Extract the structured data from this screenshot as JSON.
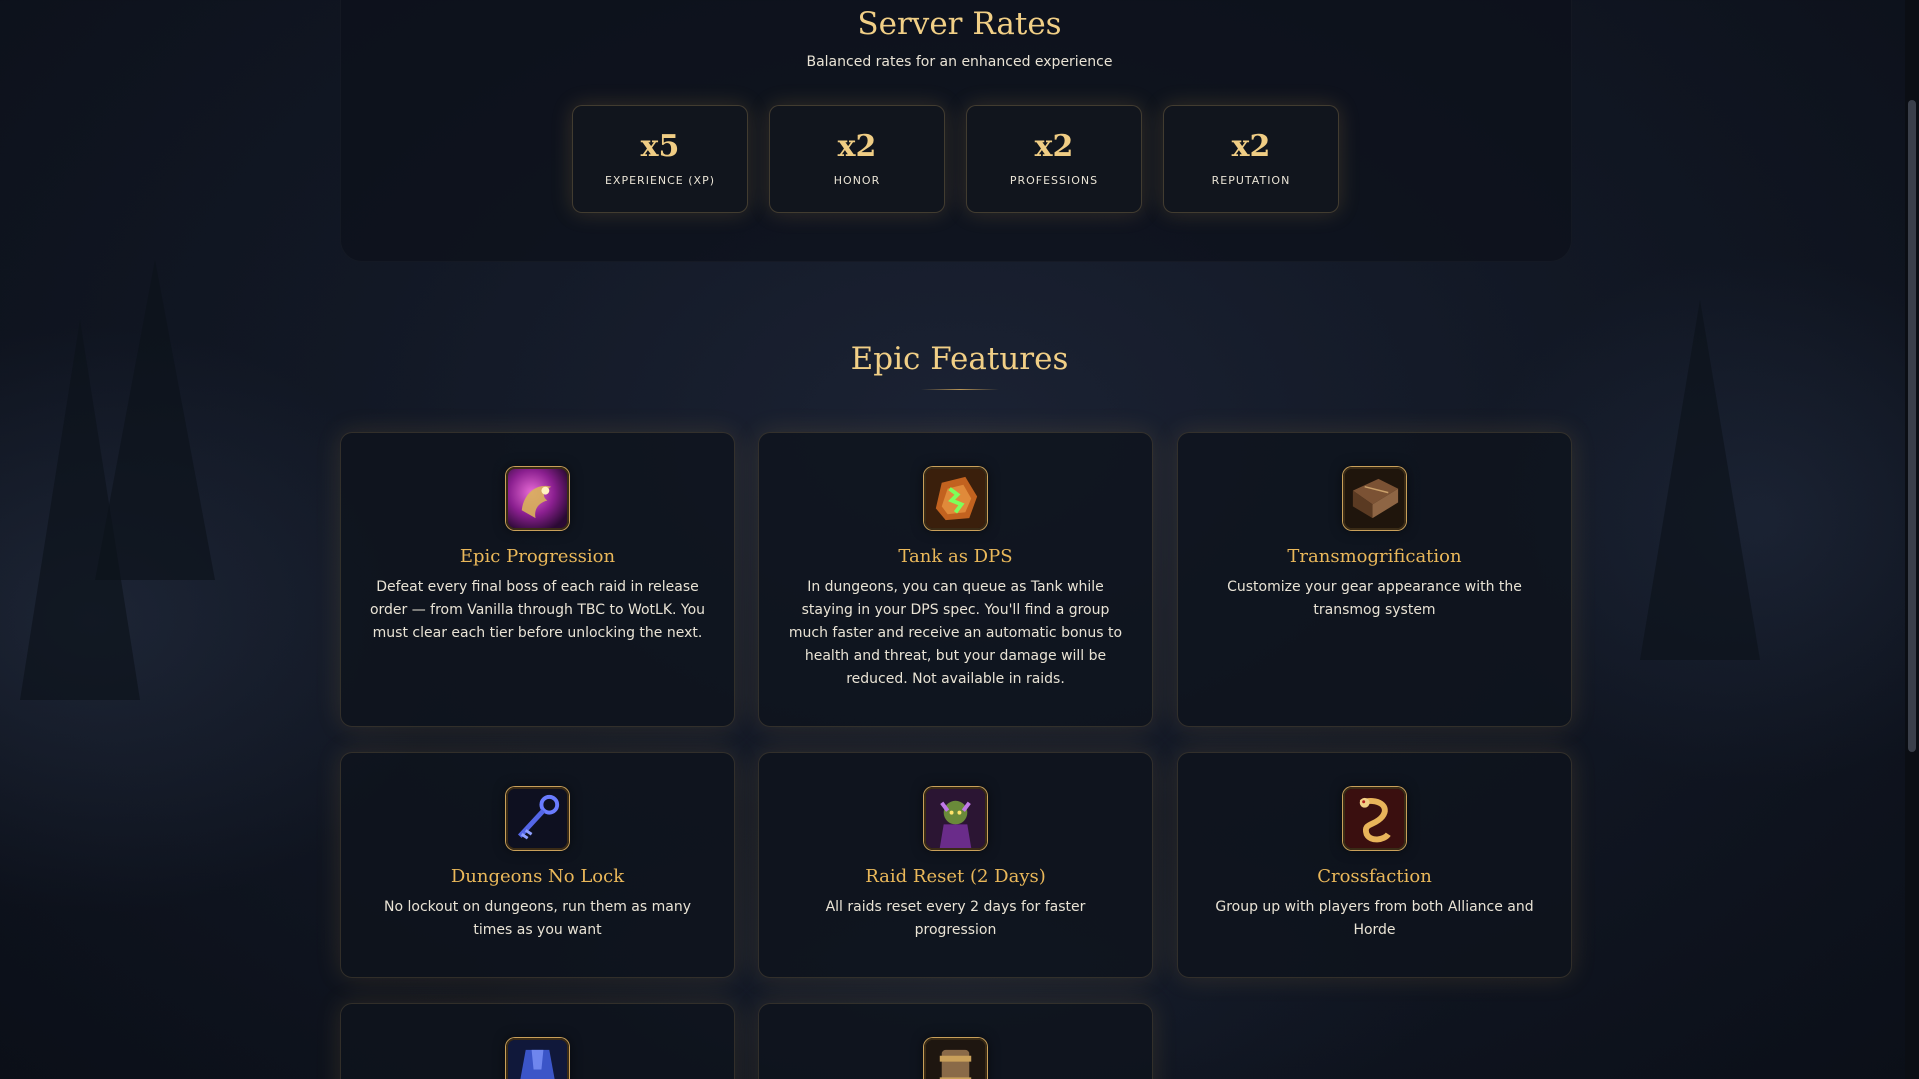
{
  "server_rates": {
    "title": "Server Rates",
    "subtitle": "Balanced rates for an enhanced experience",
    "rates": [
      {
        "value": "x5",
        "label": "EXPERIENCE (XP)"
      },
      {
        "value": "x2",
        "label": "HONOR"
      },
      {
        "value": "x2",
        "label": "PROFESSIONS"
      },
      {
        "value": "x2",
        "label": "REPUTATION"
      }
    ]
  },
  "features": {
    "title": "Epic Features",
    "items": [
      {
        "icon": "dragon-orb-icon",
        "title": "Epic Progression",
        "description": "Defeat every final boss of each raid in release order — from Vanilla through TBC to WotLK. You must clear each tier before unlocking the next."
      },
      {
        "icon": "green-rune-stone-icon",
        "title": "Tank as DPS",
        "description": "In dungeons, you can queue as Tank while staying in your DPS spec. You'll find a group much faster and receive an automatic bonus to health and threat, but your damage will be reduced. Not available in raids."
      },
      {
        "icon": "leather-book-icon",
        "title": "Transmogrification",
        "description": "Customize your gear appearance with the transmog system"
      },
      {
        "icon": "key-icon",
        "title": "Dungeons No Lock",
        "description": "No lockout on dungeons, run them as many times as you want"
      },
      {
        "icon": "purple-boss-icon",
        "title": "Raid Reset (2 Days)",
        "description": "All raids reset every 2 days for faster progression"
      },
      {
        "icon": "golden-serpent-icon",
        "title": "Crossfaction",
        "description": "Group up with players from both Alliance and Horde"
      },
      {
        "icon": "blue-robe-icon",
        "title": "",
        "description": ""
      },
      {
        "icon": "scroll-case-icon",
        "title": "",
        "description": ""
      }
    ]
  },
  "colors": {
    "accent_gold": "#f0cd84",
    "title_gold": "#eab85a",
    "background": "#121825"
  }
}
